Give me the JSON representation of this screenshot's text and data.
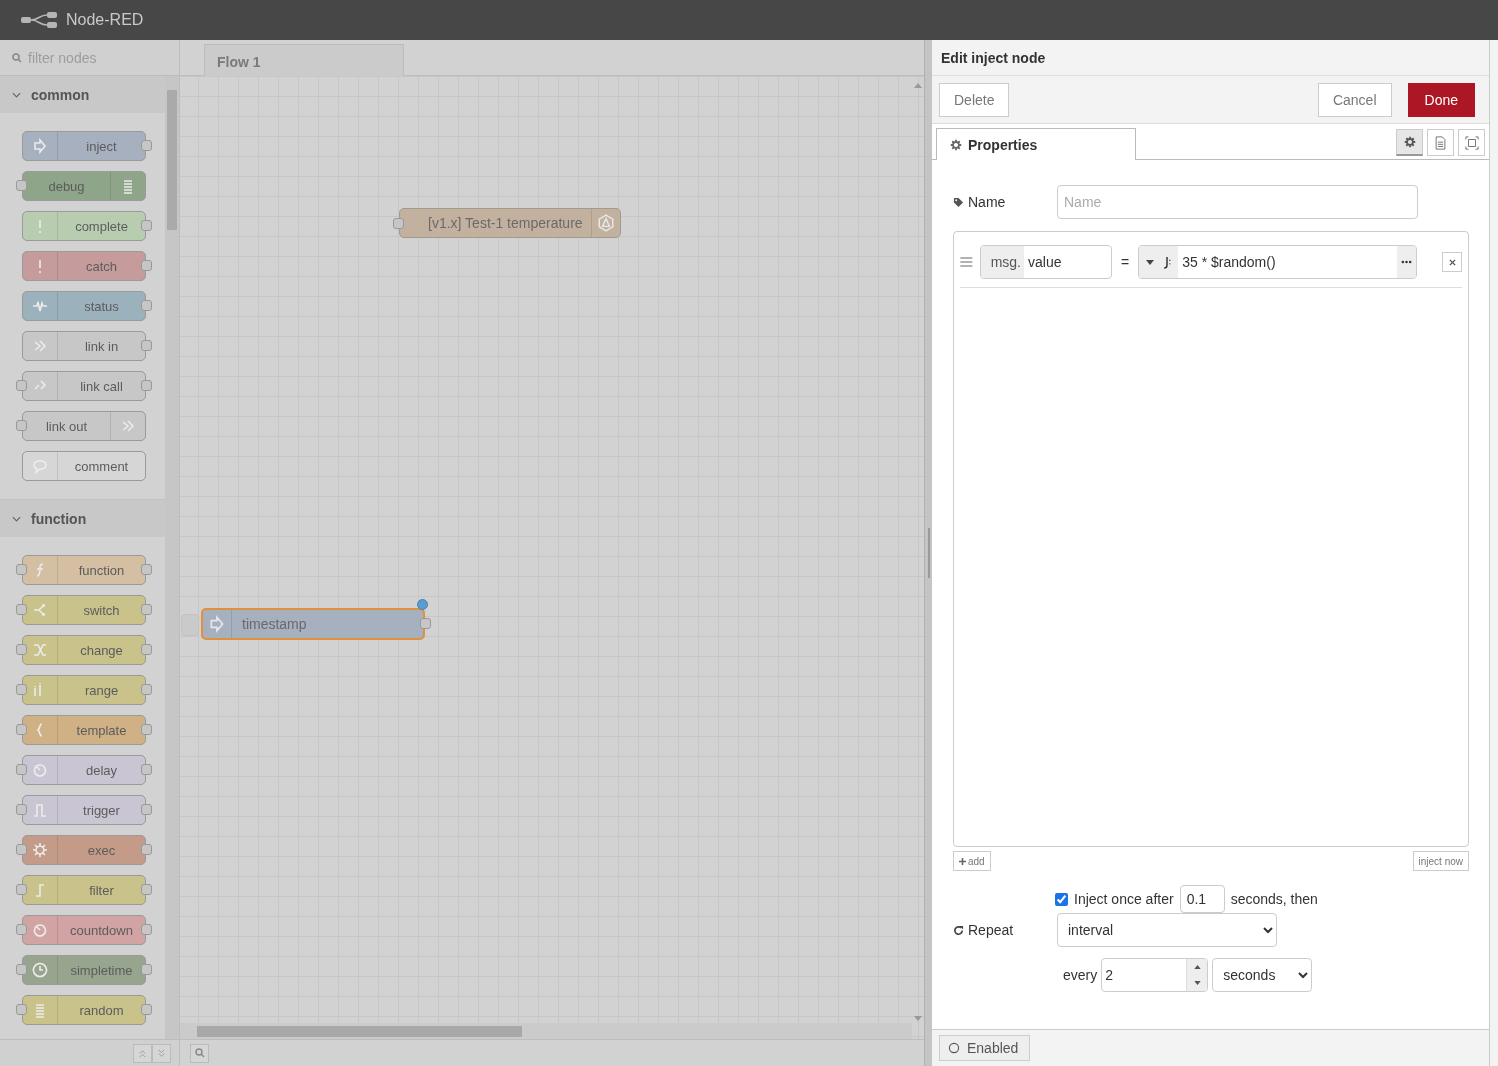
{
  "header": {
    "title": "Node-RED"
  },
  "palette": {
    "search_placeholder": "filter nodes",
    "categories": [
      {
        "name": "common",
        "expanded": true,
        "nodes": [
          {
            "label": "inject",
            "kind": "arrow",
            "color": "#a6b0bf",
            "input": false,
            "output": true,
            "icon_right": false
          },
          {
            "label": "debug",
            "kind": "lines",
            "color": "#8fa58a",
            "input": true,
            "output": false,
            "icon_right": true
          },
          {
            "label": "complete",
            "kind": "exclaim",
            "color": "#b8cdb0",
            "input": false,
            "output": true,
            "icon_right": false
          },
          {
            "label": "catch",
            "kind": "exclaim",
            "color": "#c59b9b",
            "input": false,
            "output": true,
            "icon_right": false
          },
          {
            "label": "status",
            "kind": "wave",
            "color": "#9bb2bd",
            "input": false,
            "output": true,
            "icon_right": false
          },
          {
            "label": "link in",
            "kind": "link",
            "color": "#c7c7c7",
            "input": false,
            "output": true,
            "icon_right": false
          },
          {
            "label": "link call",
            "kind": "linkcall",
            "color": "#c7c7c7",
            "input": true,
            "output": true,
            "icon_right": false
          },
          {
            "label": "link out",
            "kind": "link",
            "color": "#c7c7c7",
            "input": true,
            "output": false,
            "icon_right": true
          },
          {
            "label": "comment",
            "kind": "bubble",
            "color": "#d6d6d6",
            "input": false,
            "output": false,
            "icon_right": false
          }
        ]
      },
      {
        "name": "function",
        "expanded": true,
        "nodes": [
          {
            "label": "function",
            "kind": "func",
            "color": "#d4bfa2",
            "input": true,
            "output": true,
            "icon_right": false
          },
          {
            "label": "switch",
            "kind": "switch",
            "color": "#c9c28a",
            "input": true,
            "output": true,
            "icon_right": false
          },
          {
            "label": "change",
            "kind": "shuffle",
            "color": "#c9c28a",
            "input": true,
            "output": true,
            "icon_right": false
          },
          {
            "label": "range",
            "kind": "range",
            "color": "#c9c28a",
            "input": true,
            "output": true,
            "icon_right": false
          },
          {
            "label": "template",
            "kind": "brace",
            "color": "#cfb185",
            "input": true,
            "output": true,
            "icon_right": false
          },
          {
            "label": "delay",
            "kind": "timer",
            "color": "#c9c5d3",
            "input": true,
            "output": true,
            "icon_right": false
          },
          {
            "label": "trigger",
            "kind": "pulse",
            "color": "#c9c5d3",
            "input": true,
            "output": true,
            "icon_right": false
          },
          {
            "label": "exec",
            "kind": "gear",
            "color": "#c39b88",
            "input": true,
            "output": true,
            "icon_right": false
          },
          {
            "label": "filter",
            "kind": "step",
            "color": "#c9c28a",
            "input": true,
            "output": true,
            "icon_right": false
          },
          {
            "label": "countdown",
            "kind": "timer",
            "color": "#d2a3a3",
            "input": true,
            "output": true,
            "icon_right": false
          },
          {
            "label": "simpletime",
            "kind": "clock",
            "color": "#97a58f",
            "input": true,
            "output": true,
            "icon_right": false
          },
          {
            "label": "random",
            "kind": "lines",
            "color": "#c9c28a",
            "input": true,
            "output": true,
            "icon_right": false
          }
        ]
      }
    ]
  },
  "workspace": {
    "tabs": [
      {
        "label": "Flow 1",
        "selected": true
      }
    ],
    "nodes": [
      {
        "label": "[v1.x] Test-1 temperature",
        "kind": "hexagon",
        "color": "#c3b19f",
        "input": true,
        "output": false,
        "icon_right": true,
        "selected": false,
        "changed": false
      },
      {
        "label": "timestamp",
        "kind": "arrow",
        "color": "#a6b0bf",
        "input": false,
        "output": true,
        "icon_right": false,
        "selected": true,
        "changed": true
      }
    ]
  },
  "editor": {
    "title": "Edit inject node",
    "delete_button": "Delete",
    "cancel_button": "Cancel",
    "done_button": "Done",
    "tabs": [
      {
        "label": "Properties",
        "selected": true
      }
    ],
    "side_tabs": [
      {
        "kind": "gear",
        "selected": true
      },
      {
        "kind": "page",
        "selected": false
      },
      {
        "kind": "frame",
        "selected": false
      }
    ],
    "name_field": {
      "label": "Name",
      "placeholder": "Name"
    },
    "properties": [
      {
        "prefix": "msg.",
        "key": "value",
        "operator": "=",
        "expression": "35 * $random()"
      }
    ],
    "add_button": "add",
    "inject_now_button": "inject now",
    "inject_once": {
      "checked": true,
      "label": "Inject once after",
      "value": "0.1",
      "suffix": "seconds, then"
    },
    "repeat": {
      "label": "Repeat",
      "mode": "interval",
      "every_label": "every",
      "every_value": "2",
      "unit": "seconds"
    },
    "footer": {
      "enabled_label": "Enabled"
    }
  }
}
